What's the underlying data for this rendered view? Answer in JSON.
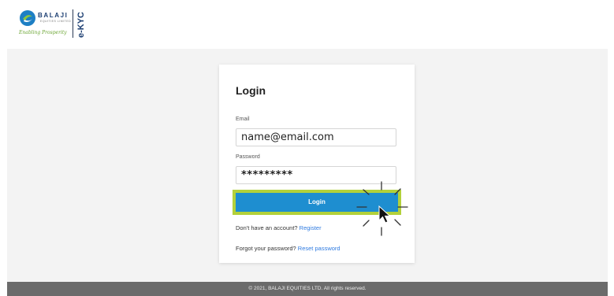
{
  "header": {
    "logo": {
      "brand": "BALAJI",
      "sub": "EQUITIES LIMITED",
      "tagline": "Enabling Prosperity",
      "product": "e-KYC"
    }
  },
  "login": {
    "title": "Login",
    "email_label": "Email",
    "email_value": "name@email.com",
    "password_label": "Password",
    "password_value": "*********",
    "button_label": "Login",
    "register_prompt": "Don't have an account?",
    "register_link": "Register",
    "forgot_prompt": "Forgot your password?",
    "reset_link": "Reset password"
  },
  "footer": {
    "text": "© 2021, BALAJI EQUITIES LTD. All rights reserved."
  },
  "colors": {
    "button": "#1e8ed0",
    "highlight": "#b3d13a",
    "link": "#2f7be0",
    "footer": "#6b6b6b",
    "brand_navy": "#1d3f72",
    "brand_green": "#6aa532"
  }
}
